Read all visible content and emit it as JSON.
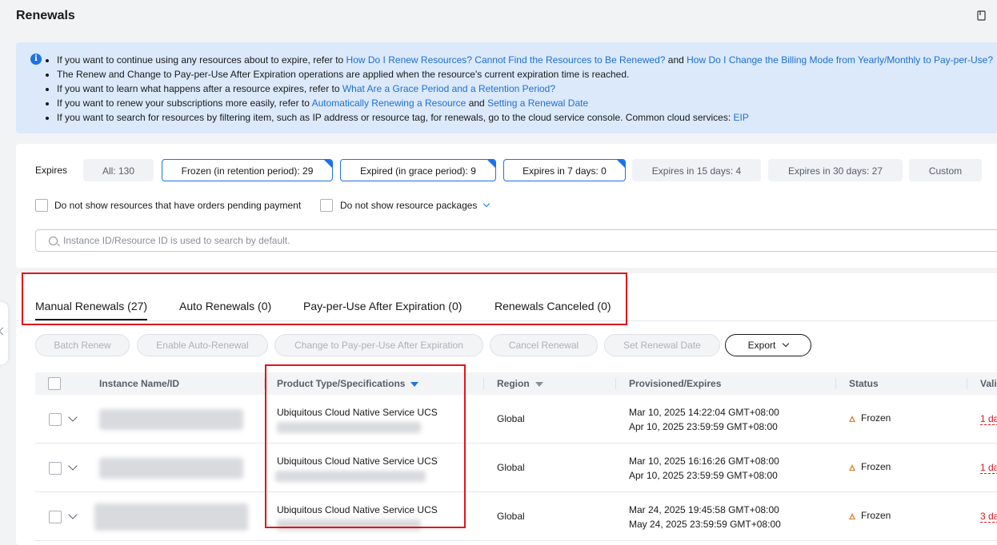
{
  "page": {
    "title": "Renewals",
    "top_right_icon": "book-icon"
  },
  "notice": {
    "icon": "info-icon",
    "lines": [
      {
        "parts": [
          {
            "t": "If you want to continue using any resources about to expire, refer to "
          },
          {
            "t": "How Do I Renew Resources? Cannot Find the Resources to Be Renewed?",
            "link": true
          },
          {
            "t": " and "
          },
          {
            "t": "How Do I Change the Billing Mode from Yearly/Monthly to Pay-per-Use?",
            "link": true
          }
        ]
      },
      {
        "parts": [
          {
            "t": "The Renew and Change to Pay-per-Use After Expiration operations are applied when the resource's current expiration time is reached."
          }
        ]
      },
      {
        "parts": [
          {
            "t": "If you want to learn what happens after a resource expires, refer to "
          },
          {
            "t": "What Are a Grace Period and a Retention Period?",
            "link": true
          }
        ]
      },
      {
        "parts": [
          {
            "t": "If you want to renew your subscriptions more easily, refer to "
          },
          {
            "t": "Automatically Renewing a Resource",
            "link": true
          },
          {
            "t": " and "
          },
          {
            "t": "Setting a Renewal Date",
            "link": true
          }
        ]
      },
      {
        "parts": [
          {
            "t": "If you want to search for resources by filtering item, such as IP address or resource tag, for renewals, go to the cloud service console. Common cloud services: "
          },
          {
            "t": "EIP",
            "link": true
          }
        ]
      }
    ]
  },
  "filters": {
    "expires_label": "Expires",
    "chips": [
      {
        "label": "All: 130",
        "selected": false
      },
      {
        "label": "Frozen (in retention period): 29",
        "selected": true
      },
      {
        "label": "Expired (in grace period): 9",
        "selected": true
      },
      {
        "label": "Expires in 7 days: 0",
        "selected": true
      },
      {
        "label": "Expires in 15 days: 4",
        "selected": false
      },
      {
        "label": "Expires in 30 days: 27",
        "selected": false
      },
      {
        "label": "Custom",
        "selected": false
      }
    ],
    "checkbox_pending": "Do not show resources that have orders pending payment",
    "checkbox_packages": "Do not show resource packages",
    "search_placeholder": "Instance ID/Resource ID is used to search by default."
  },
  "tabs": [
    {
      "label": "Manual Renewals (27)",
      "active": true
    },
    {
      "label": "Auto Renewals (0)",
      "active": false
    },
    {
      "label": "Pay-per-Use After Expiration (0)",
      "active": false
    },
    {
      "label": "Renewals Canceled (0)",
      "active": false
    }
  ],
  "toolbar": {
    "batch_renew": "Batch Renew",
    "enable_auto": "Enable Auto-Renewal",
    "change_ppu": "Change to Pay-per-Use After Expiration",
    "cancel_renewal": "Cancel Renewal",
    "set_date": "Set Renewal Date",
    "export": "Export"
  },
  "table": {
    "columns": {
      "name": "Instance Name/ID",
      "product": "Product Type/Specifications",
      "region": "Region",
      "provisioned": "Provisioned/Expires",
      "status": "Status",
      "validity": "Vali"
    },
    "rows": [
      {
        "product": "Ubiquitous Cloud Native Service UCS",
        "region": "Global",
        "provisioned": "Mar 10, 2025 14:22:04 GMT+08:00",
        "expires": "Apr 10, 2025 23:59:59 GMT+08:00",
        "status": "Frozen",
        "validity": "1 da"
      },
      {
        "product": "Ubiquitous Cloud Native Service UCS",
        "region": "Global",
        "provisioned": "Mar 10, 2025 16:16:26 GMT+08:00",
        "expires": "Apr 10, 2025 23:59:59 GMT+08:00",
        "status": "Frozen",
        "validity": "1 da"
      },
      {
        "product": "Ubiquitous Cloud Native Service UCS",
        "region": "Global",
        "provisioned": "Mar 24, 2025 19:45:58 GMT+08:00",
        "expires": "May 24, 2025 23:59:59 GMT+08:00",
        "status": "Frozen",
        "validity": "3 da"
      }
    ]
  }
}
